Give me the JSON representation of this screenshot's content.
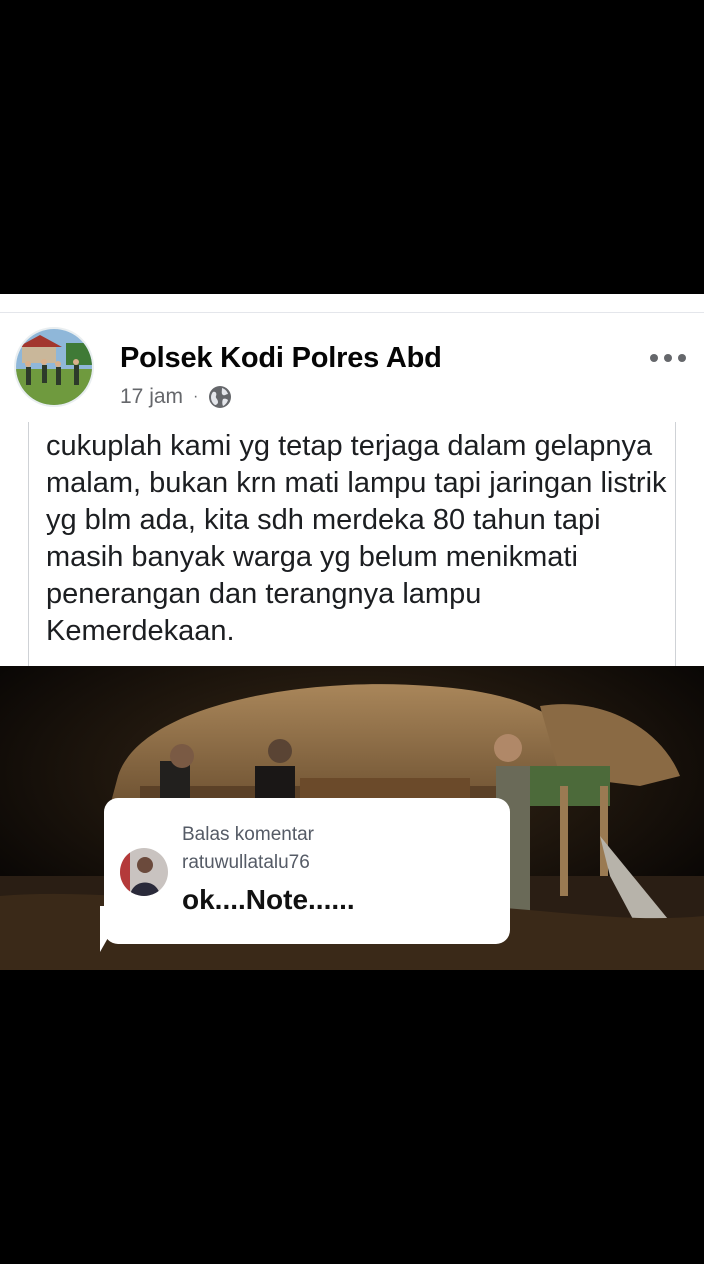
{
  "post": {
    "author": "Polsek Kodi Polres Abd",
    "time": "17 jam",
    "separator": "·",
    "privacy_icon": "globe-icon",
    "more_icon": "more-horizontal-icon",
    "text": "cukuplah kami yg tetap terjaga dalam gelapnya malam, bukan krn mati lampu tapi jaringan listrik yg blm ada, kita sdh merdeka 80 tahun tapi masih banyak warga yg belum menikmati penerangan dan terangnya lampu Kemerdekaan."
  },
  "reply": {
    "title": "Balas komentar",
    "username": "ratuwullatalu76",
    "comment": "ok....Note......"
  },
  "colors": {
    "background": "#000000",
    "card": "#ffffff",
    "name": "#050505",
    "meta": "#65676b"
  }
}
